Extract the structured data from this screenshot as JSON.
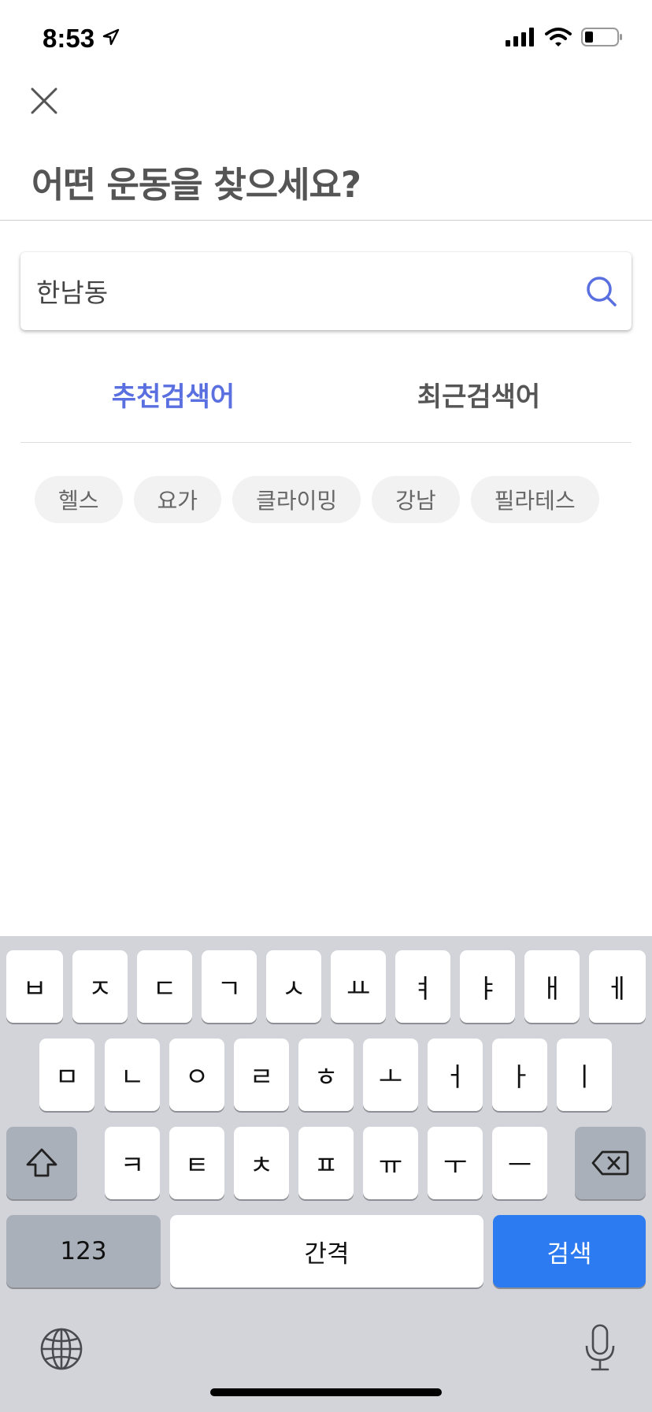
{
  "status_bar": {
    "time": "8:53"
  },
  "header": {
    "title": "어떤 운동을 찾으세요?"
  },
  "search": {
    "value": "한남동"
  },
  "tabs": [
    {
      "label": "추천검색어",
      "active": true
    },
    {
      "label": "최근검색어",
      "active": false
    }
  ],
  "chips": [
    "헬스",
    "요가",
    "클라이밍",
    "강남",
    "필라테스"
  ],
  "keyboard": {
    "row1": [
      "ㅂ",
      "ㅈ",
      "ㄷ",
      "ㄱ",
      "ㅅ",
      "ㅛ",
      "ㅕ",
      "ㅑ",
      "ㅐ",
      "ㅔ"
    ],
    "row2": [
      "ㅁ",
      "ㄴ",
      "ㅇ",
      "ㄹ",
      "ㅎ",
      "ㅗ",
      "ㅓ",
      "ㅏ",
      "ㅣ"
    ],
    "row3": [
      "ㅋ",
      "ㅌ",
      "ㅊ",
      "ㅍ",
      "ㅠ",
      "ㅜ",
      "ㅡ"
    ],
    "numbers_label": "123",
    "space_label": "간격",
    "return_label": "검색"
  },
  "colors": {
    "accent": "#5a6fe0",
    "keyboard_bg": "#d2d4da",
    "return_key": "#2d7bf0"
  },
  "icons": [
    "location-arrow-icon",
    "signal-icon",
    "wifi-icon",
    "battery-icon",
    "close-icon",
    "search-icon",
    "shift-icon",
    "backspace-icon",
    "globe-icon",
    "microphone-icon"
  ]
}
